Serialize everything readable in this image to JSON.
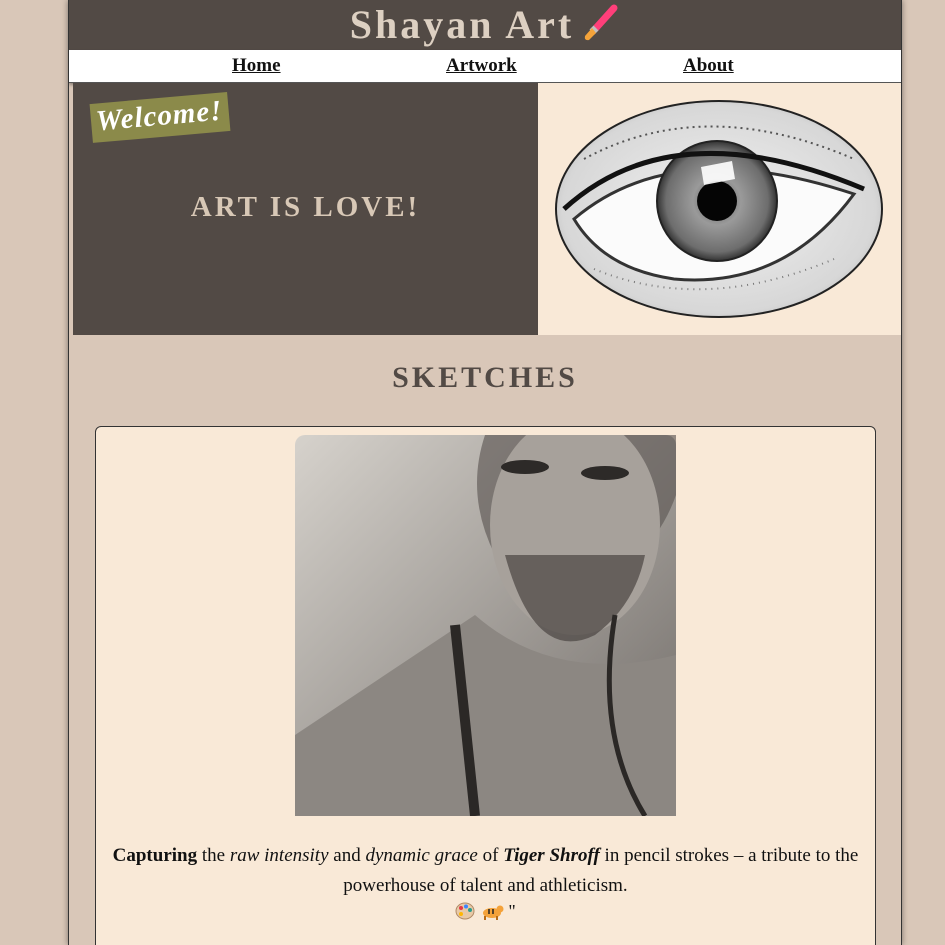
{
  "header": {
    "title": "Shayan Art"
  },
  "nav": {
    "items": [
      "Home",
      "Artwork",
      "About"
    ]
  },
  "hero": {
    "welcome": "Welcome!",
    "tagline": "ART IS LOVE!"
  },
  "section": {
    "title": "SKETCHES"
  },
  "card": {
    "caption": {
      "w1": "Capturing",
      "t1": " the ",
      "w2": "raw intensity",
      "t2": " and ",
      "w3": "dynamic grace",
      "t3": " of ",
      "w4": "Tiger Shroff",
      "t4": " in pencil strokes – a tribute to the powerhouse of talent and athleticism."
    },
    "emoji_trailer": " \""
  },
  "colors": {
    "header_bg": "#524a45",
    "page_bg": "#d9c7b8",
    "card_bg": "#f9e9d7",
    "welcome_bg": "#8b8a4a"
  },
  "icons": [
    "paintbrush-icon",
    "palette-icon",
    "tiger-icon"
  ]
}
